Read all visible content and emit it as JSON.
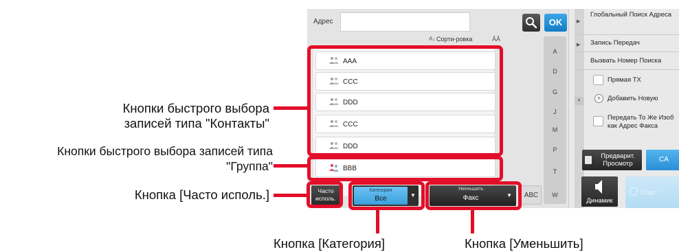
{
  "screen": {
    "address_label": "Адрес",
    "ok_label": "OK",
    "sort_label": "Сорти-ровка",
    "sort_glyph": "A↓",
    "sort2_glyph": "ĀĀ",
    "contacts": [
      {
        "label": "AAA",
        "icon": "contact-icon"
      },
      {
        "label": "CCC",
        "icon": "contact-icon"
      },
      {
        "label": "DDD",
        "icon": "contact-icon"
      },
      {
        "label": "CCC",
        "icon": "contact-icon"
      },
      {
        "label": "DDD",
        "icon": "contact-icon"
      }
    ],
    "group": {
      "label": "BBB",
      "icon": "group-icon"
    },
    "alpha_index": [
      "A",
      "D",
      "G",
      "J",
      "M",
      "P",
      "T",
      "W"
    ],
    "abc_label": "ABC",
    "frequent_label_line1": "Часто",
    "frequent_label_line2": "исполь.",
    "category": {
      "caption": "Категория",
      "value": "Все"
    },
    "reduce": {
      "caption": "Уменьшить",
      "value": "Факс"
    },
    "right_panel": {
      "global_search": "Глобальный Поиск Адреса",
      "send_log": "Запись Передач",
      "recall_search": "Вызвать Номер Поиска",
      "direct_tx": "Прямая TX",
      "add_new": "Добавить Новую",
      "same_image_line1": "Передать То Же Изоб",
      "same_image_line2": "как Адрес Факса",
      "preview_line1": "Предварит.",
      "preview_line2": "Просмотр",
      "ca": "CA",
      "speaker": "Динамик",
      "start": "Старт"
    }
  },
  "annotations": {
    "contacts_line1": "Кнопки быстрого выбора",
    "contacts_line2": "записей типа \"Контакты\"",
    "group_line1": "Кнопки быстрого выбора записей типа",
    "group_line2": "\"Группа\"",
    "frequent": "Кнопка [Часто исполь.]",
    "category": "Кнопка [Категория]",
    "reduce": "Кнопка [Уменьшить]"
  },
  "colors": {
    "callout_red": "#e30e2a",
    "ok_blue": "#1a8bd6",
    "category_blue": "#4aaee6",
    "screen_bg": "#e4e4e4"
  }
}
